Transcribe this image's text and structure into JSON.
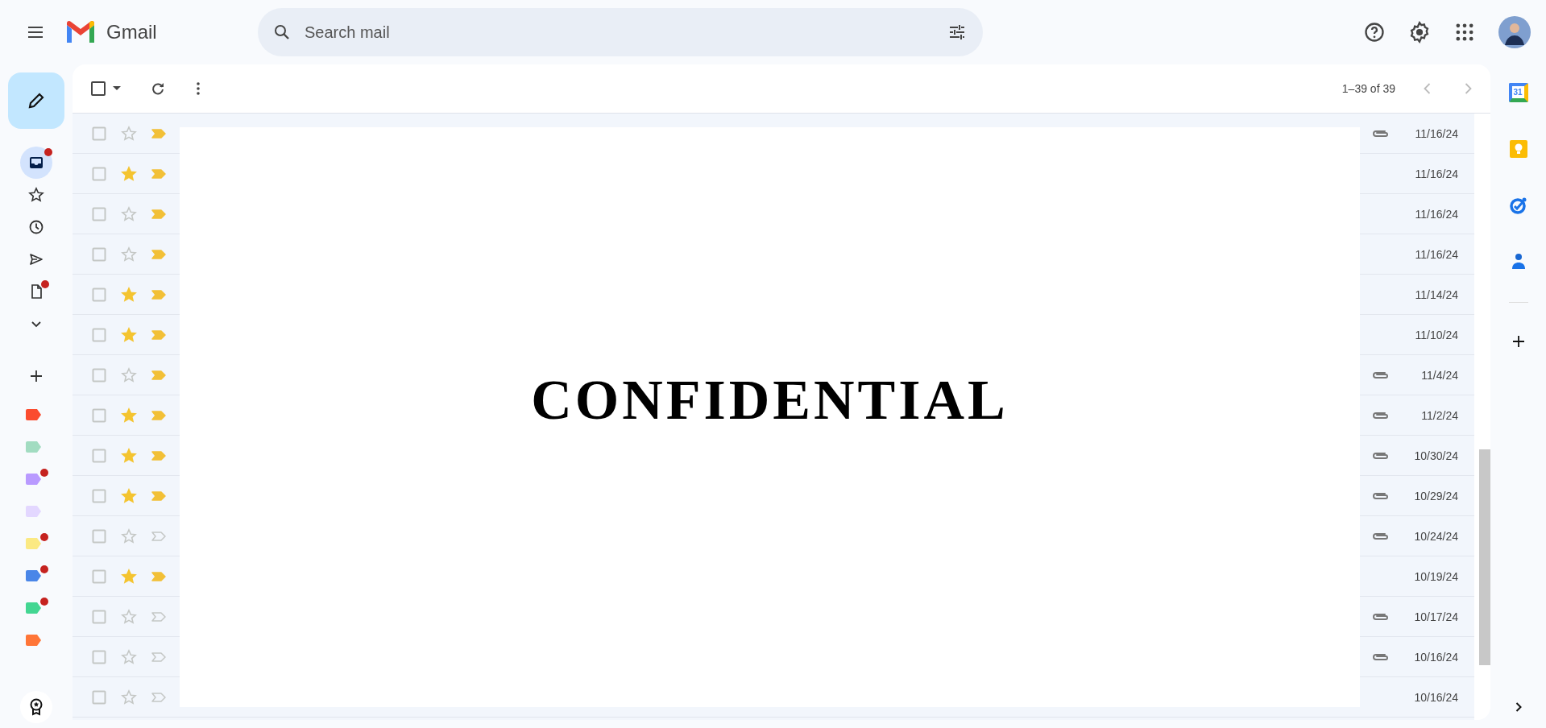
{
  "header": {
    "app_name": "Gmail",
    "search": {
      "placeholder": "Search mail"
    }
  },
  "nav": [
    {
      "kind": "inbox",
      "selected": true,
      "dot": true
    },
    {
      "kind": "starred",
      "selected": false,
      "dot": false
    },
    {
      "kind": "snoozed",
      "selected": false,
      "dot": false
    },
    {
      "kind": "sent",
      "selected": false,
      "dot": false
    },
    {
      "kind": "drafts",
      "selected": false,
      "dot": true
    },
    {
      "kind": "more",
      "selected": false,
      "dot": false
    }
  ],
  "labels": [
    {
      "color": "#fb4c2f",
      "dot": false
    },
    {
      "color": "#a2dcc1",
      "dot": false
    },
    {
      "color": "#b99aff",
      "dot": true
    },
    {
      "color": "#e3d7ff",
      "dot": false
    },
    {
      "color": "#fbe983",
      "dot": true
    },
    {
      "color": "#4a86e8",
      "dot": true
    },
    {
      "color": "#43d692",
      "dot": true
    },
    {
      "color": "#ff7537",
      "dot": false
    }
  ],
  "toolbar": {
    "select_all_checked": false,
    "range": "1–39 of 39"
  },
  "side": {
    "calendar_day": "31"
  },
  "rows": [
    {
      "checked": false,
      "starred": false,
      "important": true,
      "attachment": true,
      "date": "11/16/24"
    },
    {
      "checked": false,
      "starred": true,
      "important": true,
      "attachment": false,
      "date": "11/16/24"
    },
    {
      "checked": false,
      "starred": false,
      "important": true,
      "attachment": false,
      "date": "11/16/24"
    },
    {
      "checked": false,
      "starred": false,
      "important": true,
      "attachment": false,
      "date": "11/16/24"
    },
    {
      "checked": false,
      "starred": true,
      "important": true,
      "attachment": false,
      "date": "11/14/24"
    },
    {
      "checked": false,
      "starred": true,
      "important": true,
      "attachment": false,
      "date": "11/10/24"
    },
    {
      "checked": false,
      "starred": false,
      "important": true,
      "attachment": true,
      "date": "11/4/24"
    },
    {
      "checked": false,
      "starred": true,
      "important": true,
      "attachment": true,
      "date": "11/2/24"
    },
    {
      "checked": false,
      "starred": true,
      "important": true,
      "attachment": true,
      "date": "10/30/24"
    },
    {
      "checked": false,
      "starred": true,
      "important": true,
      "attachment": true,
      "date": "10/29/24"
    },
    {
      "checked": false,
      "starred": false,
      "important": false,
      "attachment": true,
      "date": "10/24/24"
    },
    {
      "checked": false,
      "starred": true,
      "important": true,
      "attachment": false,
      "date": "10/19/24"
    },
    {
      "checked": false,
      "starred": false,
      "important": false,
      "attachment": true,
      "date": "10/17/24"
    },
    {
      "checked": false,
      "starred": false,
      "important": false,
      "attachment": true,
      "date": "10/16/24"
    },
    {
      "checked": false,
      "starred": false,
      "important": false,
      "attachment": false,
      "date": "10/16/24"
    }
  ],
  "redaction": {
    "text": "CONFIDENTIAL"
  }
}
